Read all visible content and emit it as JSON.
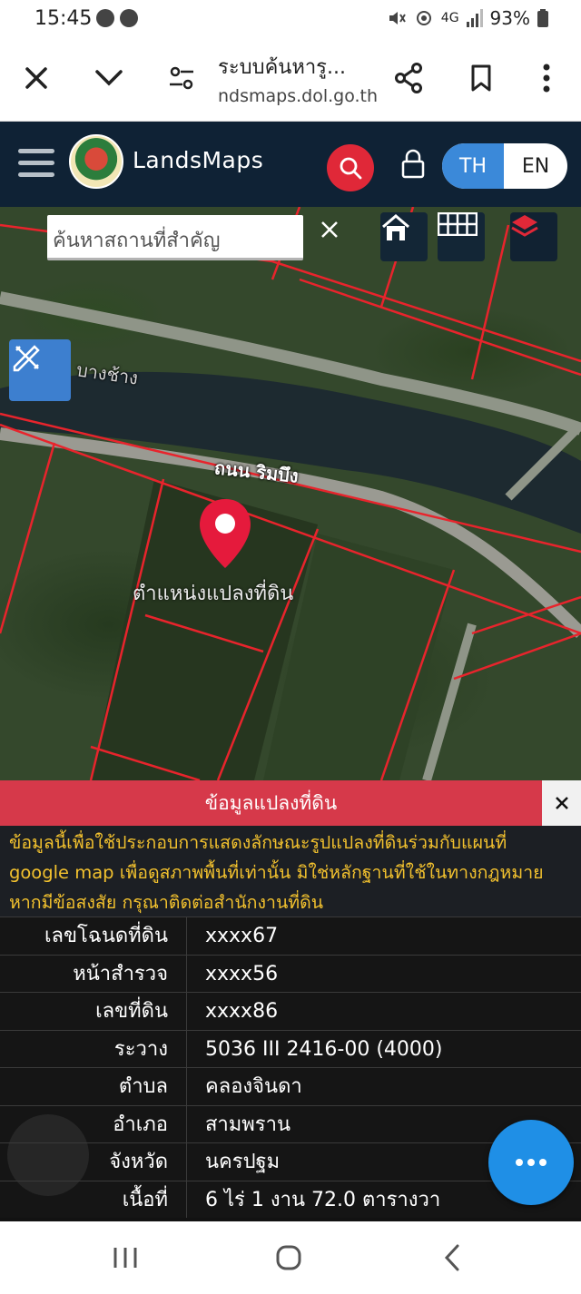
{
  "status_bar": {
    "time": "15:45",
    "network": "4G",
    "battery": "93%"
  },
  "browser": {
    "page_title": "ระบบค้นหารู...",
    "domain": "ndsmaps.dol.go.th"
  },
  "app": {
    "title": "LandsMaps",
    "lang_th": "TH",
    "lang_en": "EN",
    "accent_color": "#e02838",
    "toggle_color": "#3b89d9"
  },
  "map": {
    "search_placeholder": "ค้นหาสถานที่สำคัญ",
    "road_upper": "บางช้าง",
    "road_main": "ถนน ริมบึง",
    "pin_label": "ตำแหน่งแปลงที่ดิน"
  },
  "panel": {
    "header": "ข้อมูลแปลงที่ดิน",
    "disclaimer": [
      "ข้อมูลนี้เพื่อใช้ประกอบการแสดงลักษณะรูปแปลงที่ดินร่วมกับแผนที่",
      "google map เพื่อดูสภาพพื้นที่เท่านั้น มิใช่หลักฐานที่ใช้ในทางกฎหมาย",
      "หากมีข้อสงสัย กรุณาติดต่อสำนักงานที่ดิน"
    ],
    "rows": [
      {
        "label": "เลขโฉนดที่ดิน",
        "value": "xxxx67"
      },
      {
        "label": "หน้าสำรวจ",
        "value": "xxxx56"
      },
      {
        "label": "เลขที่ดิน",
        "value": "xxxx86"
      },
      {
        "label": "ระวาง",
        "value": "5036 III 2416-00 (4000)"
      },
      {
        "label": "ตำบล",
        "value": "คลองจินดา"
      },
      {
        "label": "อำเภอ",
        "value": "สามพราน"
      },
      {
        "label": "จังหวัด",
        "value": "นครปฐม"
      },
      {
        "label": "เนื้อที่",
        "value": "6 ไร่ 1 งาน 72.0 ตารางวา"
      }
    ],
    "header_color": "#d6394a",
    "disclaimer_color": "#f2c12e"
  },
  "fab": {
    "label": "•••"
  }
}
